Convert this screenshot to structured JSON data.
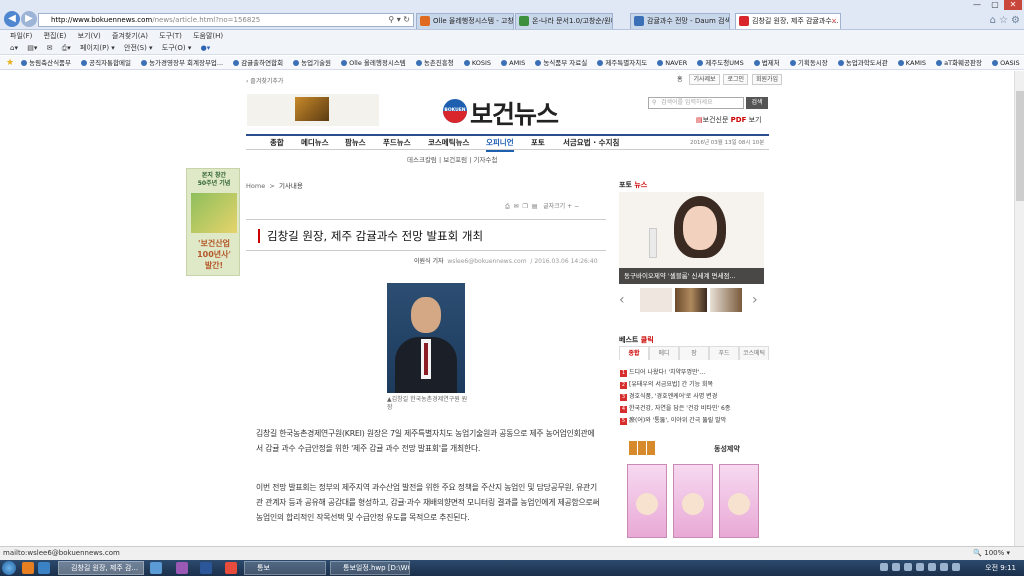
{
  "browser": {
    "address_domain": "http://www.bokuennews.com",
    "address_path": "/news/article.html?no=156825",
    "tabs": [
      {
        "label": "Olle 올레행정시스템 - 고창순/...",
        "color": "#e06a1f"
      },
      {
        "label": "온-나라 문서1.0/고창순/원예...",
        "color": "#3e8f3e"
      },
      {
        "label": "감귤과수 전망 - Daum 검색",
        "color": "#3b6fb6"
      },
      {
        "label": "김창길 원장, 제주 감귤과수...",
        "color": "#d8262c"
      }
    ],
    "menu": [
      "파일(F)",
      "편집(E)",
      "보기(V)",
      "즐겨찾기(A)",
      "도구(T)",
      "도움말(H)"
    ],
    "commands": [
      "페이지(P) ▾",
      "안전(S) ▾",
      "도구(O) ▾"
    ],
    "favorites": [
      "농림축산식품부",
      "공직자통합메일",
      "농가경영장부 회계장부업...",
      "감귤출하연합회",
      "농업기술원",
      "Olle 올레행정시스템",
      "농촌진흥청",
      "KOSIS",
      "AMIS",
      "농식품부 자료실",
      "제주특별자치도",
      "NAVER",
      "제주도청UMS",
      "법제처",
      "기획동시장",
      "농업과학도서관",
      "KAMIS",
      "aT화훼공판장",
      "OASIS"
    ]
  },
  "site": {
    "top_link": "› 즐겨찾기추가",
    "user_links": {
      "home": "홈",
      "all": "기사제보",
      "login": "로그인",
      "join": "회원가입"
    },
    "logo_mark": "BOKUEN",
    "logo_name": "보건뉴스",
    "search_placeholder": "검색어를 입력하세요",
    "search_button": "검색",
    "pdf_prefix": "보건신문",
    "pdf_label": "PDF",
    "pdf_suffix": "보기",
    "nav": [
      "종합",
      "메디뉴스",
      "팜뉴스",
      "푸드뉴스",
      "코스메틱뉴스",
      "오피니언",
      "포토",
      "서금요법 · 수지침"
    ],
    "nav_date": "2016년 03월 13일 08시 10분",
    "subnav": "데스크칼럼  |  보건포럼  |  기자수첩",
    "side_ad": {
      "line1": "본지 창간",
      "line2": "50주년 기념",
      "line3": "'보건산업",
      "line4": "100년사'",
      "line5": "발간!"
    }
  },
  "article": {
    "breadcrumb_home": "Home",
    "breadcrumb_sep": ">",
    "breadcrumb_section": "기사내용",
    "font_size_label": "글자크기",
    "title": "김창길 원장, 제주 감귤과수 전망 발표회 개최",
    "reporter": "이원식 기자",
    "email": "wslee6@bokuennews.com",
    "date": "/  2016.03.06 14:26:40",
    "photo_caption": "▲김창길 한국농촌경제연구원 원장",
    "para1": "김창길 한국농촌경제연구원(KREI) 원장은 7일 제주특별자치도 농업기술원과 공동으로 제주 농어업인회관에서 감귤 과수 수급안정을 위한 '제주 감귤 과수 전망 발표회'를 개최한다.",
    "para2": "이번 전망 발표회는 정부의 제주지역 과수산업 발전을 위한 주요 정책을 주산지 농업인 및 담당공무원, 유관기관 관계자 등과 공유해 공감대를 형성하고, 감귤·과수 재배의향면적 모니터링 결과를 농업인에게 제공함으로써 농업인의 합리적인 작목선택 및 수급안정 유도를 목적으로 추진된다."
  },
  "sidebar": {
    "photo_news_label": "포토",
    "photo_news_label_red": "뉴스",
    "photo_caption": "동구바이오제약 '셀블룸' 신세계 면세점...",
    "best_label": "베스트",
    "best_label_red": "클릭",
    "best_tabs": [
      "종합",
      "메디",
      "팜",
      "푸드",
      "코스메틱"
    ],
    "best_items": [
      "드디어 나왔다! '치약뚜껑만'…",
      "[유태우의 서금요법] 간 기능 회복",
      "경호식품, '경호엔케어'로 사명 변경",
      "한국건강, 자연을 담은 '건강 비타민' 6종",
      "瘀(어)와 '통뚫', 이야위 간극 뚫릴 말막"
    ],
    "ad_brand": "동성제약"
  },
  "status": {
    "url": "mailto:wslee6@bokuennews.com",
    "zoom": "🔍 100%  ▾"
  },
  "taskbar": {
    "windows": [
      "김창길 원장, 제주 감...",
      "통보",
      "통보일정.hwp [D:\\W0..."
    ],
    "clock": "오전 9:11"
  }
}
